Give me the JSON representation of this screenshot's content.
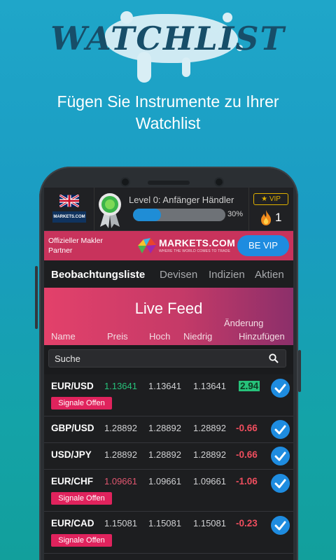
{
  "promo": {
    "title": "WATCHLIST",
    "subtitle_line1": "Fügen Sie Instrumente zu Ihrer",
    "subtitle_line2": "Watchlist"
  },
  "header": {
    "brand_mini": "MARKETS.COM",
    "level_text": "Level 0: Anfänger Händler",
    "progress_percent": 30,
    "progress_label": "30%",
    "vip_label": "VIP",
    "streak_count": "1"
  },
  "banner": {
    "text": "Offizieller Makler Partner",
    "brand": "MARKETS.COM",
    "tagline": "WHERE THE WORLD COMES TO TRADE",
    "button_label": "BE VIP"
  },
  "tabs": [
    "Beobachtungsliste",
    "Devisen",
    "Indizien",
    "Aktien"
  ],
  "feed": {
    "title": "Live Feed",
    "columns": {
      "name": "Name",
      "price": "Preis",
      "high": "Hoch",
      "low": "Niedrig",
      "change": "Änderung",
      "add": "Hinzufügen"
    }
  },
  "search": {
    "placeholder": "Suche"
  },
  "rows": [
    {
      "symbol": "EUR/USD",
      "price": "1.13641",
      "high": "1.13641",
      "low": "1.13641",
      "change": "2.94",
      "price_color": "#27c27a",
      "change_style": "positive",
      "signal": "Signale Offen"
    },
    {
      "symbol": "GBP/USD",
      "price": "1.28892",
      "high": "1.28892",
      "low": "1.28892",
      "change": "-0.66",
      "price_color": "#cfd0d2",
      "change_style": "negative",
      "signal": ""
    },
    {
      "symbol": "USD/JPY",
      "price": "1.28892",
      "high": "1.28892",
      "low": "1.28892",
      "change": "-0.66",
      "price_color": "#cfd0d2",
      "change_style": "negative",
      "signal": ""
    },
    {
      "symbol": "EUR/CHF",
      "price": "1.09661",
      "high": "1.09661",
      "low": "1.09661",
      "change": "-1.06",
      "price_color": "#e0566f",
      "change_style": "negative",
      "signal": "Signale Offen"
    },
    {
      "symbol": "EUR/CAD",
      "price": "1.15081",
      "high": "1.15081",
      "low": "1.15081",
      "change": "-0.23",
      "price_color": "#cfd0d2",
      "change_style": "negative",
      "signal": "Signale Offen"
    }
  ],
  "colors": {
    "accent_blue": "#1e8ce0",
    "signal_red": "#e0235d",
    "positive_green": "#27c27a",
    "negative_red": "#f04e5e"
  }
}
